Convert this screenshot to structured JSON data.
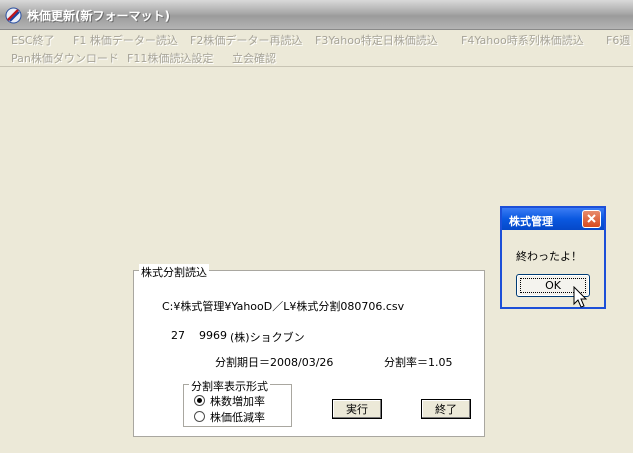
{
  "window": {
    "title": "株価更新(新フォーマット)"
  },
  "menu": {
    "row1": [
      "ESC終了",
      "F1 株価データー読込",
      "F2株価データー再読込",
      "F3Yahoo特定日株価読込",
      "F4Yahoo時系列株価読込",
      "F6週"
    ],
    "row2": [
      "Pan株価ダウンロード",
      "F11株価読込設定",
      "立会確認"
    ]
  },
  "group": {
    "title": "株式分割読込",
    "file_path": "C:¥株式管理¥YahooD／L¥株式分割080706.csv",
    "record_index": "27",
    "record_code": "9969",
    "record_name": "(株)ショクブン",
    "split_date": "分割期日＝2008/03/26",
    "split_ratio": "分割率＝1.05",
    "format_group": {
      "title": "分割率表示形式",
      "options": [
        "株数増加率",
        "株価低減率"
      ],
      "selected": 0
    },
    "execute_label": "実行",
    "close_label": "終了"
  },
  "dialog": {
    "title": "株式管理",
    "message": "終わったよ！",
    "ok_label": "OK"
  },
  "colors": {
    "dialog_title": "#0a58e0",
    "close_button": "#d64a1f",
    "face": "#ece9d8"
  }
}
